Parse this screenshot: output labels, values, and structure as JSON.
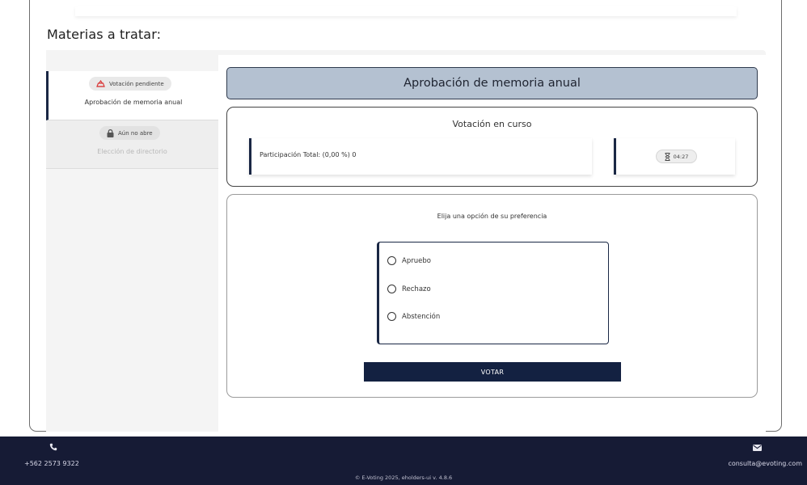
{
  "section": {
    "title": "Materias a tratar:"
  },
  "sidebar": {
    "items": [
      {
        "badge": "Votación pendiente",
        "badge_icon": "ballot-icon",
        "badge_color": "#d93a3a",
        "title": "Aprobación de memoria anual",
        "active": true
      },
      {
        "badge": "Aún no abre",
        "badge_icon": "lock-icon",
        "title": "Elección de directorio",
        "active": false
      }
    ]
  },
  "main": {
    "header_title": "Aprobación de memoria anual",
    "status": {
      "title": "Votación en curso",
      "participation": "Participación Total: (0,00 %) 0",
      "timer": "04:27"
    },
    "vote": {
      "prompt": "Elija una opción de su preferencia",
      "options": [
        "Apruebo",
        "Rechazo",
        "Abstención"
      ],
      "button_label": "VOTAR"
    }
  },
  "footer": {
    "phone": "+562 2573 9322",
    "email": "consulta@evoting.com",
    "copyright": "© E-Voting 2025, eholders-ui v. 4.8.6"
  },
  "colors": {
    "navy": "#132141",
    "header_bg": "#b4c1d1",
    "footer_bg": "#161b35",
    "alert_red": "#d93a3a"
  }
}
